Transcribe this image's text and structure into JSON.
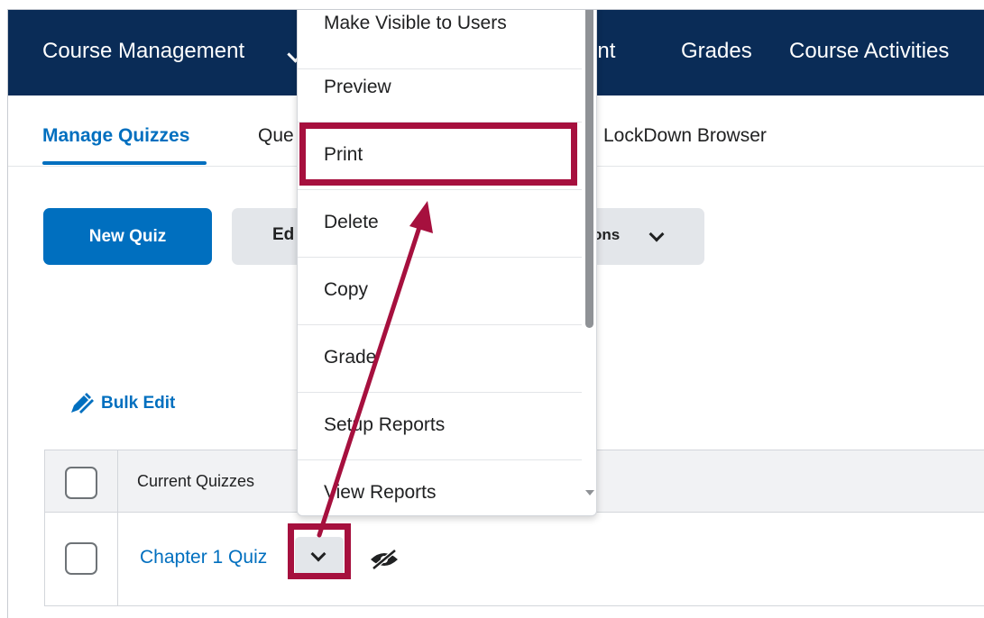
{
  "navbar": {
    "course_management": "Course Management",
    "content_partial": "ntent",
    "grades": "Grades",
    "course_activities": "Course Activities"
  },
  "tabs": {
    "manage_quizzes": "Manage Quizzes",
    "question_library_partial": "Que",
    "lockdown_browser": "LockDown Browser"
  },
  "toolbar": {
    "new_quiz": "New Quiz",
    "edit_partial": "Ed",
    "more_actions_partial": "ons"
  },
  "bulk_edit": "Bulk Edit",
  "table": {
    "header": "Current Quizzes",
    "rows": [
      {
        "name": "Chapter 1 Quiz"
      }
    ]
  },
  "menu": {
    "items": [
      "Make Visible to Users",
      "Preview",
      "Print",
      "Delete",
      "Copy",
      "Grade",
      "Setup Reports",
      "View Reports"
    ],
    "highlighted": "Print"
  },
  "colors": {
    "navbar": "#0a2c57",
    "accent_blue": "#006fbf",
    "highlight": "#a6103e"
  },
  "icons": [
    "chevron-down-icon",
    "bulk-edit-pencil-icon",
    "visibility-hidden-icon",
    "scroll-down-arrow-icon"
  ]
}
